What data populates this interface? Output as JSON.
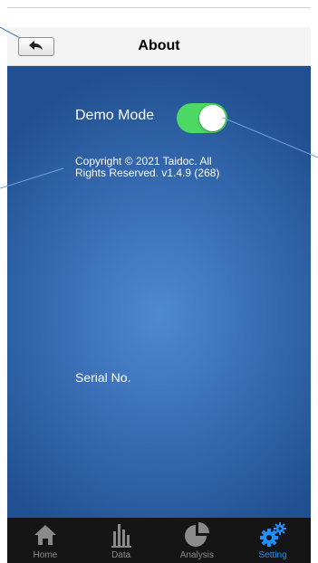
{
  "header": {
    "title": "About",
    "back_icon": "back-arrow-icon"
  },
  "settings": {
    "demo_mode_label": "Demo Mode",
    "demo_mode_on": true,
    "copyright_line1": "Copyright © 2021 Taidoc. All",
    "copyright_line2": "Rights Reserved. v1.4.9 (268)",
    "serial_label": "Serial No."
  },
  "tabbar": {
    "items": [
      {
        "label": "Home",
        "icon": "home-icon",
        "active": false
      },
      {
        "label": "Data",
        "icon": "bar-chart-icon",
        "active": false
      },
      {
        "label": "Analysis",
        "icon": "pie-chart-icon",
        "active": false
      },
      {
        "label": "Setting",
        "icon": "gears-icon",
        "active": true
      }
    ]
  },
  "colors": {
    "toggle_on": "#4cd964",
    "active_tab": "#1e90ff",
    "content_bg": "#3a6fb7"
  }
}
